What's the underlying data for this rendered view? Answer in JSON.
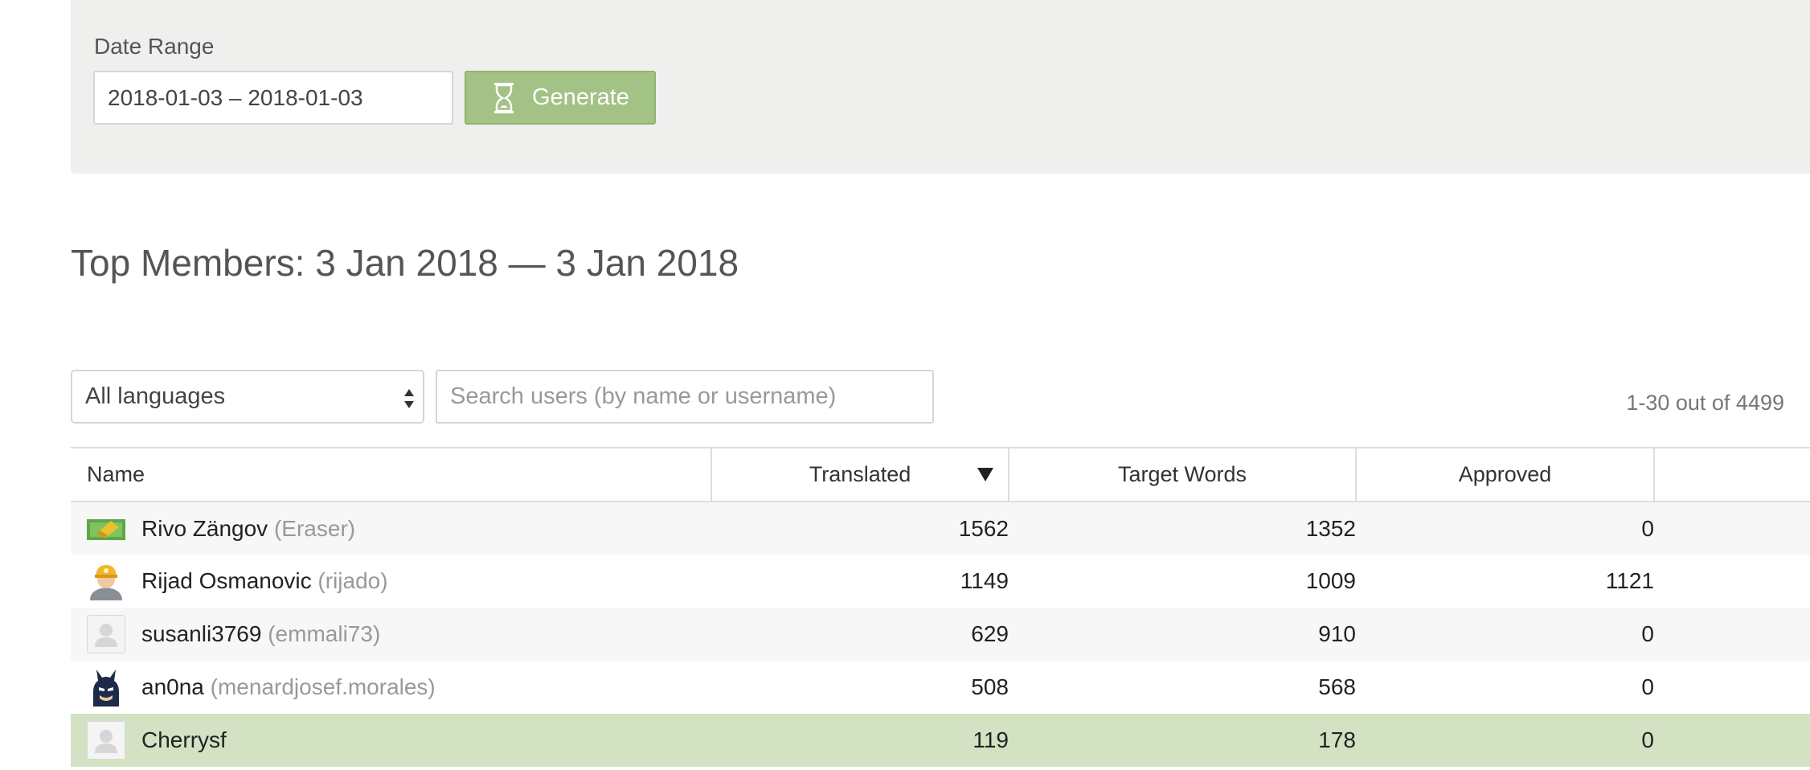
{
  "filter": {
    "date_label": "Date Range",
    "date_value": "2018-01-03 – 2018-01-03",
    "generate_label": "Generate",
    "generate_icon": "hourglass-icon",
    "accent_color": "#a3c286"
  },
  "title": "Top Members: 3 Jan 2018 — 3 Jan 2018",
  "toolbar": {
    "language_selected": "All languages",
    "search_placeholder": "Search users (by name or username)",
    "count_text": "1-30 out of 4499"
  },
  "table": {
    "columns": [
      "Name",
      "Translated",
      "Target Words",
      "Approved",
      ""
    ],
    "sorted_column": "Translated",
    "sort_direction": "desc",
    "rows": [
      {
        "name": "Rivo Zängov",
        "username": "(Eraser)",
        "avatar": "eraser-avatar-icon",
        "translated": "1562",
        "target_words": "1352",
        "approved": "0"
      },
      {
        "name": "Rijad Osmanovic",
        "username": "(rijado)",
        "avatar": "miner-avatar-icon",
        "translated": "1149",
        "target_words": "1009",
        "approved": "1121"
      },
      {
        "name": "susanli3769",
        "username": "(emmali73)",
        "avatar": "default-user-avatar-icon",
        "translated": "629",
        "target_words": "910",
        "approved": "0"
      },
      {
        "name": "an0na",
        "username": "(menardjosef.morales)",
        "avatar": "batman-avatar-icon",
        "translated": "508",
        "target_words": "568",
        "approved": "0"
      },
      {
        "name": "Cherrysf",
        "username": "",
        "avatar": "default-user-avatar-icon",
        "translated": "119",
        "target_words": "178",
        "approved": "0"
      }
    ],
    "highlight_color": "#d2e2c3"
  }
}
